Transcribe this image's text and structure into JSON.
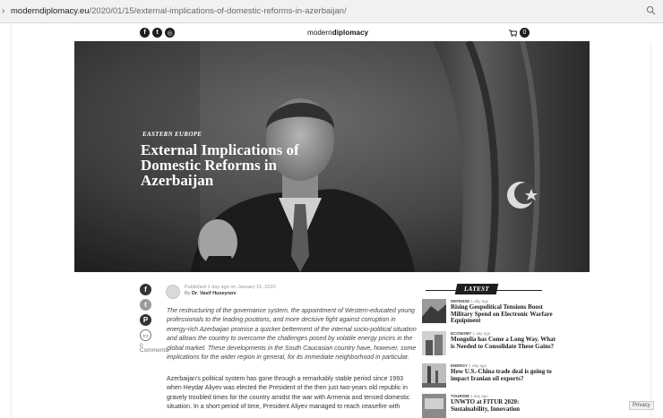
{
  "browser": {
    "url_host": "moderndiplomacy.eu",
    "url_path": "/2020/01/15/external-implications-of-domestic-reforms-in-azerbaijan/"
  },
  "nav": {
    "logo_light": "modern",
    "logo_bold": "diplomacy",
    "social": [
      {
        "icon": "facebook-icon",
        "glyph": "f"
      },
      {
        "icon": "twitter-icon",
        "glyph": "t"
      },
      {
        "icon": "instagram-icon",
        "glyph": "◎"
      }
    ],
    "cart_icon": "cart-icon",
    "cart_count": "0"
  },
  "hero": {
    "category": "EASTERN EUROPE",
    "title": "External Implications of Domestic Reforms in Azerbaijan"
  },
  "share": {
    "items": [
      {
        "icon": "facebook-icon",
        "glyph": "f"
      },
      {
        "icon": "twitter-icon",
        "glyph": "t"
      },
      {
        "icon": "pinterest-icon",
        "glyph": "P"
      },
      {
        "icon": "comment-icon",
        "glyph": "▭"
      }
    ],
    "comments_count": "0",
    "comments_label": "Comments"
  },
  "article": {
    "published": "Published 1 day ago on January 15, 2020",
    "by": "By",
    "author": "Dr. Vasif Huseynov",
    "lead": "The restructuring of the governance system, the appointment of Western-educated young professionals to the leading positions, and more decisive fight against corruption in energy-rich Azerbaijan promise a quicker betterment of the internal socio-political situation and allows the country to overcome the challenges posed by volatile energy prices in the global market. These developments in the South Caucasian country have, however, some implications for the wider region in general, for its immediate neighborhood in particular.",
    "body": "Azerbaijan's political system has gone through a remarkably stable period since 1993 when Heydar Aliyev was elected the President of the then just two-years old republic in gravely troubled times for the country amidst the war with Armenia and tensed domestic situation. In a short period of time, President Aliyev managed to reach ceasefire with"
  },
  "sidebar": {
    "latest_label": "LATEST",
    "items": [
      {
        "category": "DEFENSE",
        "time": "1 day ago",
        "title": "Rising Geopolitical Tensions Boost Military Spend on Electronic Warfare Equipment"
      },
      {
        "category": "ECONOMY",
        "time": "1 day ago",
        "title": "Mongolia has Come a Long Way. What is Needed to Consolidate These Gains?"
      },
      {
        "category": "ENERGY",
        "time": "1 day ago",
        "title": "How U.S.-China trade deal is going to impact Iranian oil exports?"
      },
      {
        "category": "TOURISM",
        "time": "1 day ago",
        "title": "UNWTO at FITUR 2020: Sustainability, Innovation"
      }
    ]
  },
  "privacy_label": "Privacy"
}
